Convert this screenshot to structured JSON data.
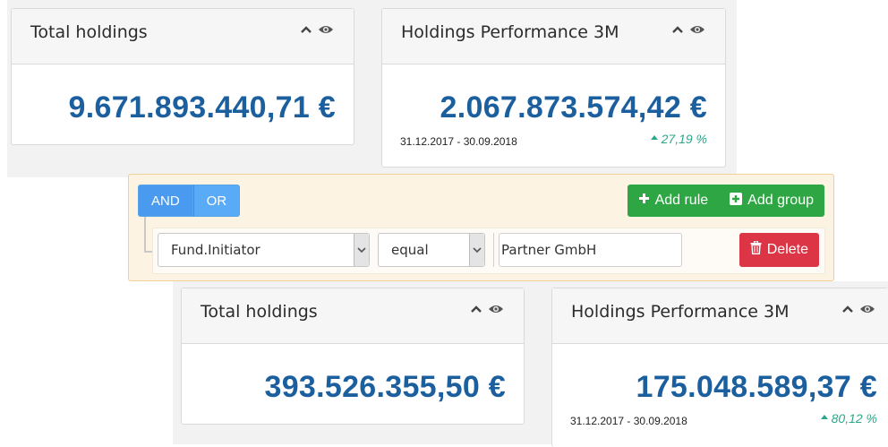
{
  "top_left_card": {
    "title": "Total holdings",
    "amount": "9.671.893.440,71 €"
  },
  "top_right_card": {
    "title": "Holdings Performance 3M",
    "amount": "2.067.873.574,42 €",
    "date_range": "31.12.2017 - 30.09.2018",
    "performance": "27,19 %"
  },
  "query_builder": {
    "and_label": "AND",
    "or_label": "OR",
    "add_rule_label": "Add rule",
    "add_group_label": "Add group",
    "rule": {
      "field": "Fund.Initiator",
      "operator": "equal",
      "value": "Partner GmbH",
      "delete_label": "Delete"
    }
  },
  "bottom_left_card": {
    "title": "Total holdings",
    "amount": "393.526.355,50 €"
  },
  "bottom_right_card": {
    "title": "Holdings Performance 3M",
    "amount": "175.048.589,37 €",
    "date_range": "31.12.2017 - 30.09.2018",
    "performance": "80,12 %"
  },
  "colors": {
    "amount": "#1b5f9e",
    "positive": "#2aa889",
    "success_button": "#2ea643",
    "danger_button": "#dc3546",
    "condition_button": "#5aabf7",
    "query_background": "#fcf3e3"
  }
}
